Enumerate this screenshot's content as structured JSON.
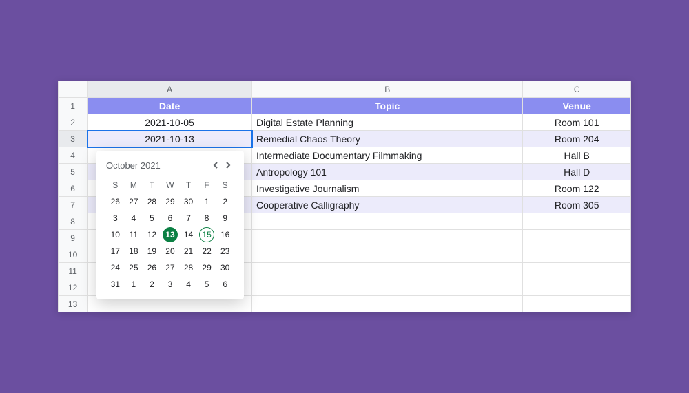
{
  "columns": {
    "A": "A",
    "B": "B",
    "C": "C"
  },
  "row_numbers": [
    "1",
    "2",
    "3",
    "4",
    "5",
    "6",
    "7",
    "8",
    "9",
    "10",
    "11",
    "12",
    "13"
  ],
  "headers": {
    "date": "Date",
    "topic": "Topic",
    "venue": "Venue"
  },
  "rows": [
    {
      "date": "2021-10-05",
      "topic": "Digital Estate Planning",
      "venue": "Room 101"
    },
    {
      "date": "2021-10-13",
      "topic": "Remedial Chaos Theory",
      "venue": "Room 204"
    },
    {
      "date": "",
      "topic": "Intermediate Documentary Filmmaking",
      "venue": "Hall B"
    },
    {
      "date": "",
      "topic": "Antropology 101",
      "venue": "Hall D"
    },
    {
      "date": "",
      "topic": "Investigative Journalism",
      "venue": "Room 122"
    },
    {
      "date": "",
      "topic": "Cooperative Calligraphy",
      "venue": "Room 305"
    }
  ],
  "selected_cell": "A3",
  "datepicker": {
    "title": "October 2021",
    "dow": [
      "S",
      "M",
      "T",
      "W",
      "T",
      "F",
      "S"
    ],
    "weeks": [
      [
        {
          "n": 26,
          "out": true
        },
        {
          "n": 27,
          "out": true
        },
        {
          "n": 28,
          "out": true
        },
        {
          "n": 29,
          "out": true
        },
        {
          "n": 30,
          "out": true
        },
        {
          "n": 1
        },
        {
          "n": 2
        }
      ],
      [
        {
          "n": 3
        },
        {
          "n": 4
        },
        {
          "n": 5
        },
        {
          "n": 6
        },
        {
          "n": 7
        },
        {
          "n": 8
        },
        {
          "n": 9
        }
      ],
      [
        {
          "n": 10
        },
        {
          "n": 11
        },
        {
          "n": 12
        },
        {
          "n": 13,
          "sel": true
        },
        {
          "n": 14
        },
        {
          "n": 15,
          "hover": true
        },
        {
          "n": 16
        }
      ],
      [
        {
          "n": 17
        },
        {
          "n": 18
        },
        {
          "n": 19
        },
        {
          "n": 20
        },
        {
          "n": 21
        },
        {
          "n": 22
        },
        {
          "n": 23
        }
      ],
      [
        {
          "n": 24
        },
        {
          "n": 25
        },
        {
          "n": 26
        },
        {
          "n": 27
        },
        {
          "n": 28
        },
        {
          "n": 29
        },
        {
          "n": 30
        }
      ],
      [
        {
          "n": 31
        },
        {
          "n": 1,
          "out": true
        },
        {
          "n": 2,
          "out": true
        },
        {
          "n": 3,
          "out": true
        },
        {
          "n": 4,
          "out": true
        },
        {
          "n": 5,
          "out": true
        },
        {
          "n": 6,
          "out": true
        }
      ]
    ]
  }
}
